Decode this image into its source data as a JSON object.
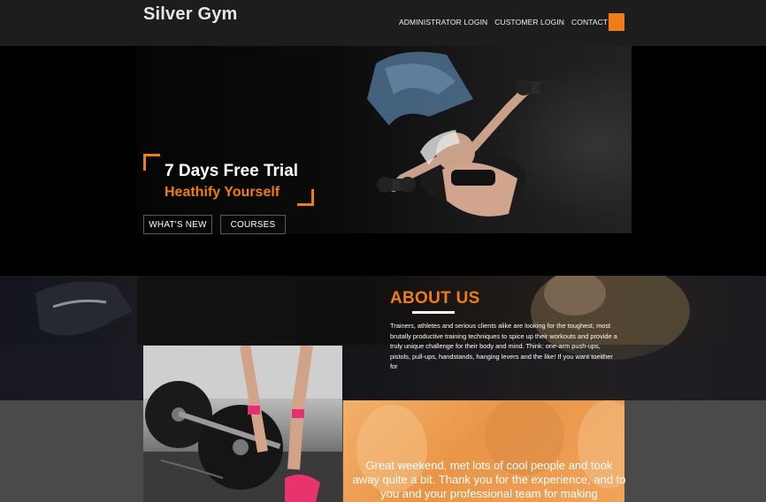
{
  "header": {
    "logo": "Silver Gym",
    "nav": [
      "ADMINISTRATOR LOGIN",
      "CUSTOMER LOGIN",
      "CONTACT"
    ],
    "menu_icon": "menu-square-icon",
    "accent_color": "#f07d13"
  },
  "hero": {
    "title": "7 Days Free Trial",
    "subtitle": "Heathify Yourself",
    "buttons": [
      "WHAT'S NEW",
      "COURSES"
    ]
  },
  "about": {
    "title": "ABOUT US",
    "text": "Trainers, athletes and serious clients alike are looking for the toughest, most brutally productive training techniques to spice up their workouts and provide a truly unique challenge for their body and mind. Think: one-arm push-ups, pistols, pull-ups, handstands, hanging levers and the like! If you want toeither for"
  },
  "testimonial": {
    "text": "Great weekend, met lots of cool people and took away quite a bit. Thank you for the experience, and to you and your professional team for making"
  }
}
